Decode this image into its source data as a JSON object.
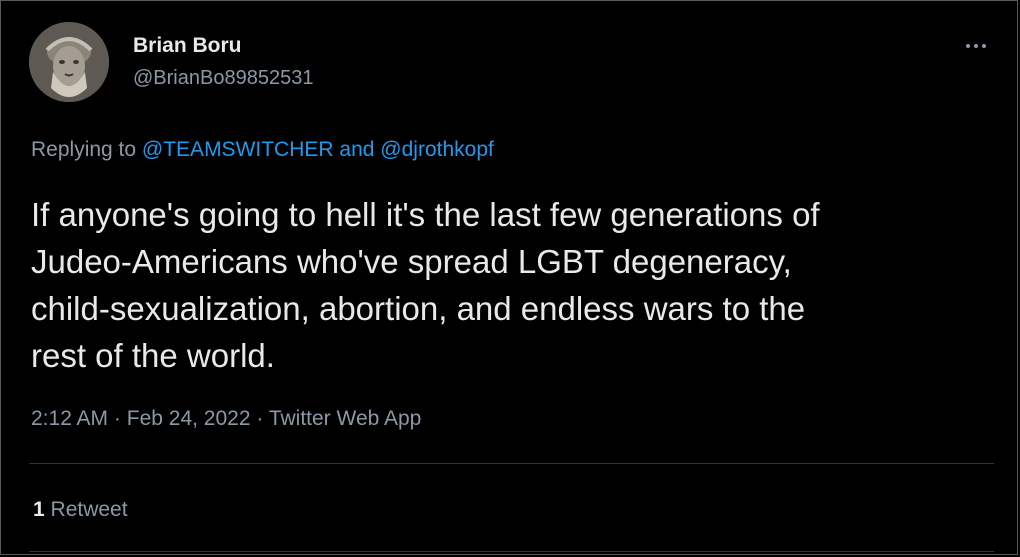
{
  "author": {
    "display_name": "Brian Boru",
    "handle": "@BrianBo89852531",
    "avatar_icon": "bust-portrait-avatar"
  },
  "more_icon": "more-dots-icon",
  "reply": {
    "prefix": "Replying to",
    "mention_1": "@TEAMSWITCHER",
    "joiner": "and",
    "mention_2": "@djrothkopf"
  },
  "tweet": {
    "lines": [
      "If anyone's going to hell it's the last few generations of",
      "Judeo-Americans who've spread LGBT degeneracy,",
      "child-sexualization, abortion, and endless wars to the",
      "rest of the world."
    ]
  },
  "meta": {
    "time": "2:12 AM",
    "separator": "·",
    "date": "Feb 24, 2022",
    "source": "Twitter Web App"
  },
  "stats": {
    "retweet_count": "1",
    "retweet_label": "Retweet"
  },
  "colors": {
    "background": "#000000",
    "text": "#e7e9ea",
    "secondary": "#8b98a5",
    "link": "#1d9bf0",
    "divider": "#2f3336"
  }
}
